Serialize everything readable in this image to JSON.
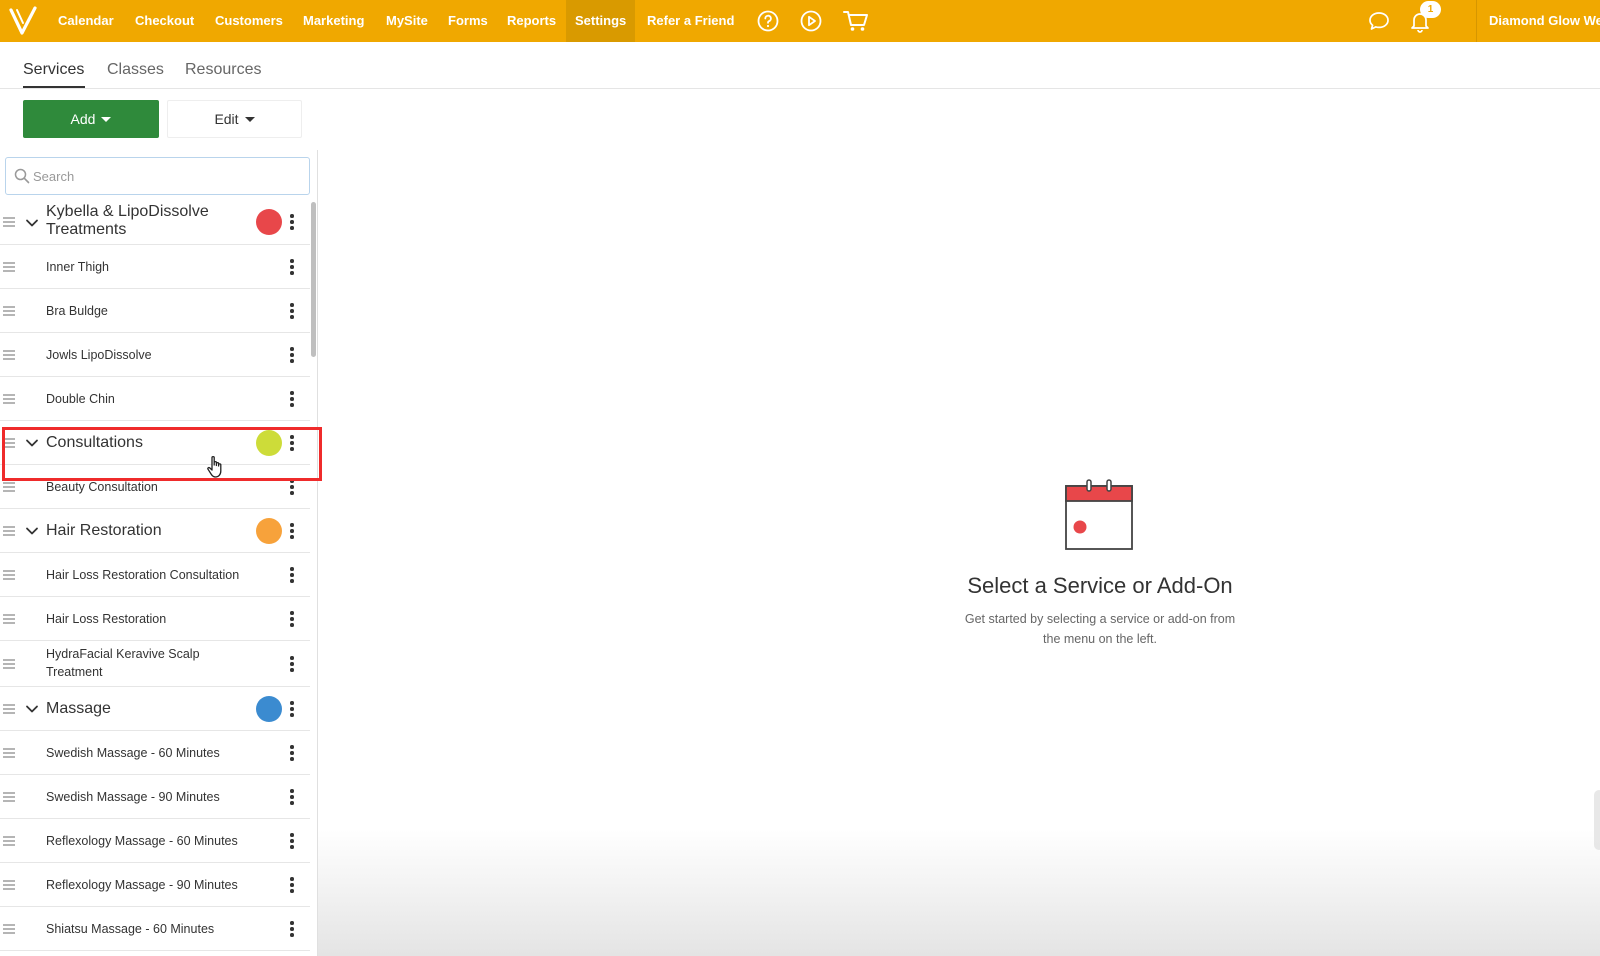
{
  "nav": {
    "items": [
      {
        "label": "Calendar"
      },
      {
        "label": "Checkout"
      },
      {
        "label": "Customers"
      },
      {
        "label": "Marketing"
      },
      {
        "label": "MySite"
      },
      {
        "label": "Forms"
      },
      {
        "label": "Reports"
      },
      {
        "label": "Settings",
        "active": true
      },
      {
        "label": "Refer a Friend"
      }
    ],
    "icons": [
      "help-icon",
      "play-icon",
      "cart-icon",
      "chat-icon",
      "bell-icon"
    ],
    "notification_count": "1",
    "account_name": "Diamond Glow We",
    "brand_color": "#f0a800"
  },
  "subtabs": [
    {
      "label": "Services",
      "active": true
    },
    {
      "label": "Classes"
    },
    {
      "label": "Resources"
    }
  ],
  "toolbar": {
    "add_label": "Add",
    "edit_label": "Edit",
    "add_color": "#2f8a3b"
  },
  "search": {
    "placeholder": "Search",
    "value": ""
  },
  "categories": [
    {
      "name_line1": "Kybella & LipoDissolve",
      "name_line2": "Treatments",
      "color": "#e8474a",
      "services": [
        "Inner Thigh",
        "Bra Buldge",
        "Jowls LipoDissolve",
        "Double Chin"
      ]
    },
    {
      "name": "Consultations",
      "color": "#cddc39",
      "selected": true,
      "services": [
        "Beauty Consultation"
      ]
    },
    {
      "name": "Hair Restoration",
      "color": "#f7a23b",
      "services": [
        "Hair Loss Restoration Consultation",
        "Hair Loss Restoration",
        "HydraFacial Keravive Scalp Treatment"
      ]
    },
    {
      "name": "Massage",
      "color": "#3b8bd0",
      "services": [
        "Swedish Massage - 60 Minutes",
        "Swedish Massage - 90 Minutes",
        "Reflexology Massage - 60 Minutes",
        "Reflexology Massage - 90 Minutes",
        "Shiatsu Massage - 60 Minutes"
      ]
    }
  ],
  "hydra_line1": "HydraFacial Keravive Scalp",
  "hydra_line2": "Treatment",
  "empty_state": {
    "title": "Select a Service or Add-On",
    "subtitle_line1": "Get started by selecting a service or add-on from",
    "subtitle_line2": "the menu on the left."
  }
}
